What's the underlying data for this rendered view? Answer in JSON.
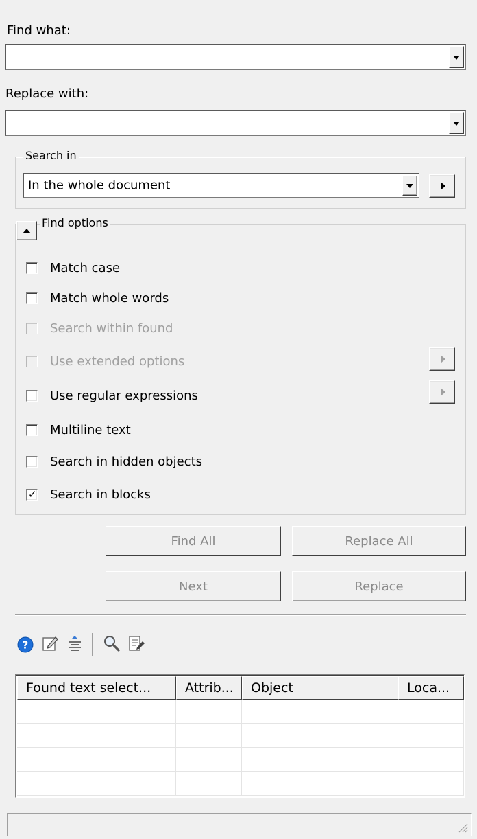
{
  "find": {
    "label": "Find what:",
    "value": ""
  },
  "replace": {
    "label": "Replace with:",
    "value": ""
  },
  "search_in": {
    "legend": "Search in",
    "value": "In the whole document"
  },
  "find_options": {
    "legend": "Find options",
    "options": [
      {
        "label": "Match case",
        "checked": false,
        "enabled": true
      },
      {
        "label": "Match whole words",
        "checked": false,
        "enabled": true
      },
      {
        "label": "Search within found",
        "checked": false,
        "enabled": false
      },
      {
        "label": "Use extended options",
        "checked": false,
        "enabled": false
      },
      {
        "label": "Use regular expressions",
        "checked": false,
        "enabled": true
      },
      {
        "label": "Multiline text",
        "checked": false,
        "enabled": true
      },
      {
        "label": "Search in hidden objects",
        "checked": false,
        "enabled": true
      },
      {
        "label": "Search in blocks",
        "checked": true,
        "enabled": true
      }
    ]
  },
  "buttons": {
    "find_all": "Find All",
    "replace_all": "Replace All",
    "next": "Next",
    "replace": "Replace"
  },
  "toolbar": {
    "icons": [
      "help-icon",
      "edit-icon",
      "align-icon",
      "zoom-icon",
      "properties-icon"
    ]
  },
  "results": {
    "columns": [
      "Found text select...",
      "Attrib...",
      "Object",
      "Loca..."
    ],
    "rows": [
      [
        "",
        "",
        "",
        ""
      ],
      [
        "",
        "",
        "",
        ""
      ],
      [
        "",
        "",
        "",
        ""
      ],
      [
        "",
        "",
        "",
        ""
      ]
    ]
  },
  "colors": {
    "background": "#f0f0f0",
    "disabled_text": "#a0a0a0",
    "help_blue": "#1e6fd9"
  }
}
